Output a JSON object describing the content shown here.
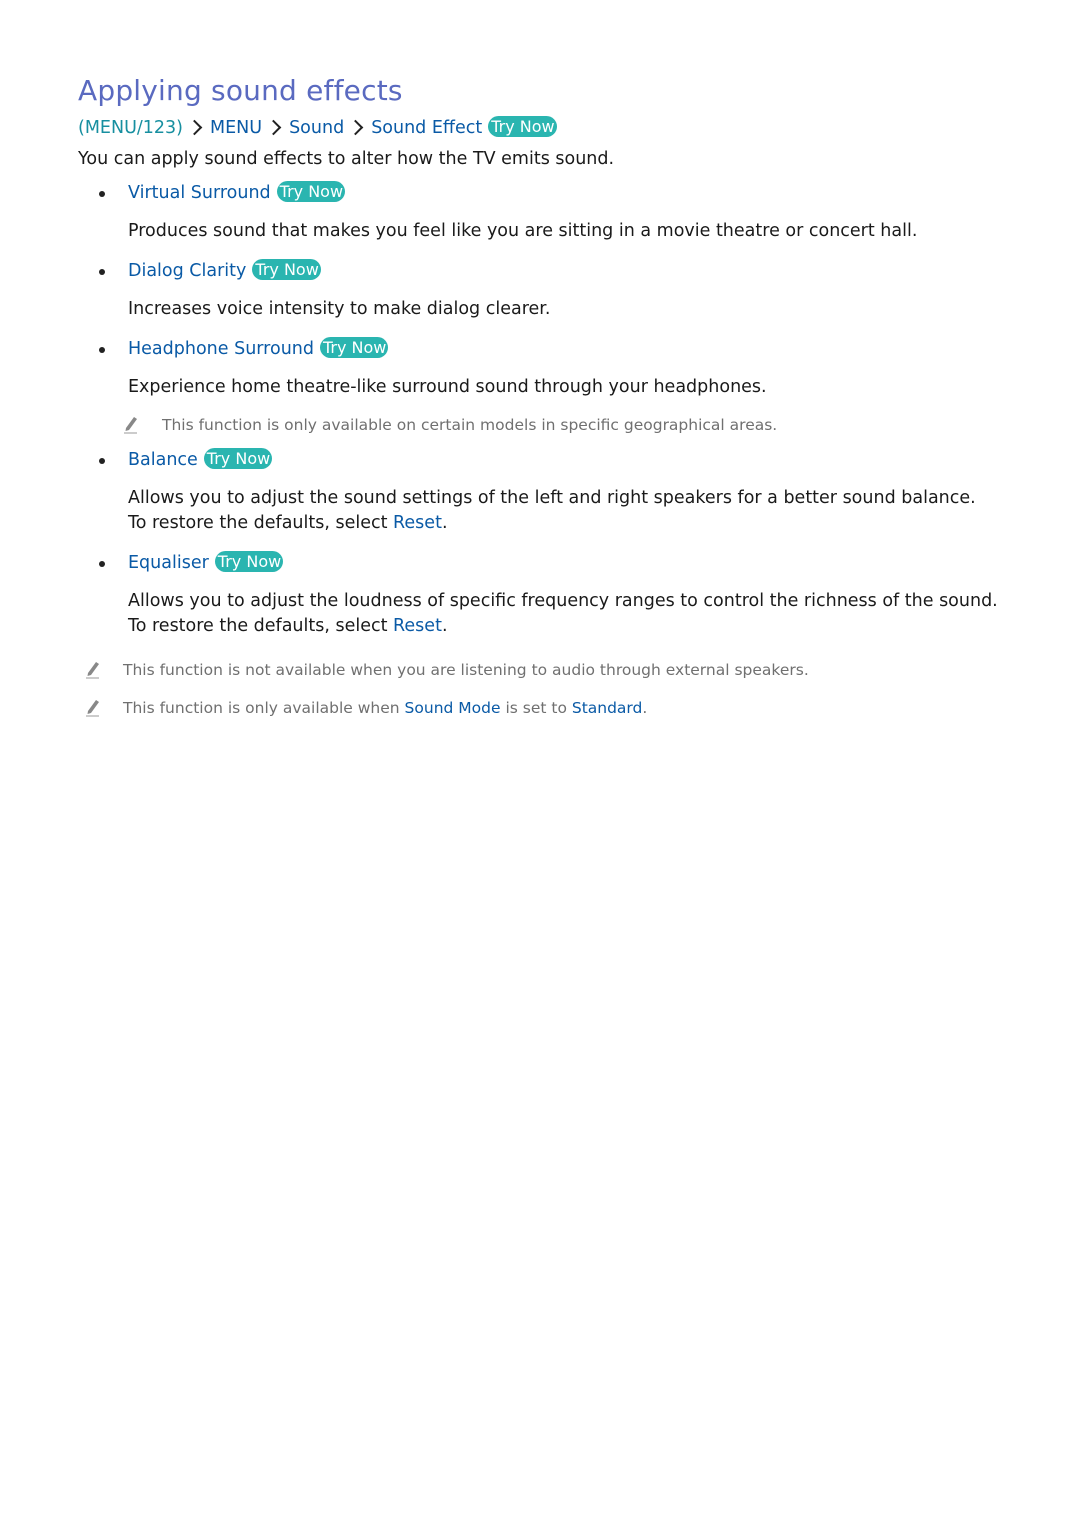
{
  "title": "Applying sound effects",
  "path": {
    "root": "(MENU/123)",
    "steps": [
      "MENU",
      "Sound",
      "Sound Effect"
    ],
    "try_now": "Try Now"
  },
  "intro": "You can apply sound effects to alter how the TV emits sound.",
  "items": [
    {
      "title": "Virtual Surround",
      "try_now": "Try Now",
      "desc": "Produces sound that makes you feel like you are sitting in a movie theatre or concert hall."
    },
    {
      "title": "Dialog Clarity",
      "try_now": "Try Now",
      "desc": "Increases voice intensity to make dialog clearer."
    },
    {
      "title": "Headphone Surround",
      "try_now": "Try Now",
      "desc": "Experience home theatre-like surround sound through your headphones.",
      "note": "This function is only available on certain models in specific geographical areas."
    },
    {
      "title": "Balance",
      "try_now": "Try Now",
      "desc": "Allows you to adjust the sound settings of the left and right speakers for a better sound balance.",
      "desc2_pre": "To restore the defaults, select ",
      "desc2_link": "Reset",
      "desc2_post": "."
    },
    {
      "title": "Equaliser",
      "try_now": "Try Now",
      "desc": "Allows you to adjust the loudness of specific frequency ranges to control the richness of the sound. To restore the defaults, select ",
      "desc_link": "Reset",
      "desc_post": "."
    }
  ],
  "notes": [
    {
      "text": "This function is not available when you are listening to audio through external speakers."
    },
    {
      "pre": "This function is only available when ",
      "link1": "Sound Mode",
      "mid": " is set to ",
      "link2": "Standard",
      "post": "."
    }
  ],
  "icons": {
    "note": "pencil-icon",
    "separator": "chevron-right-icon"
  },
  "colors": {
    "title": "#5a6ac0",
    "link": "#0a5aa6",
    "try_now_bg": "#2ab5b0",
    "note_text": "#707070"
  }
}
